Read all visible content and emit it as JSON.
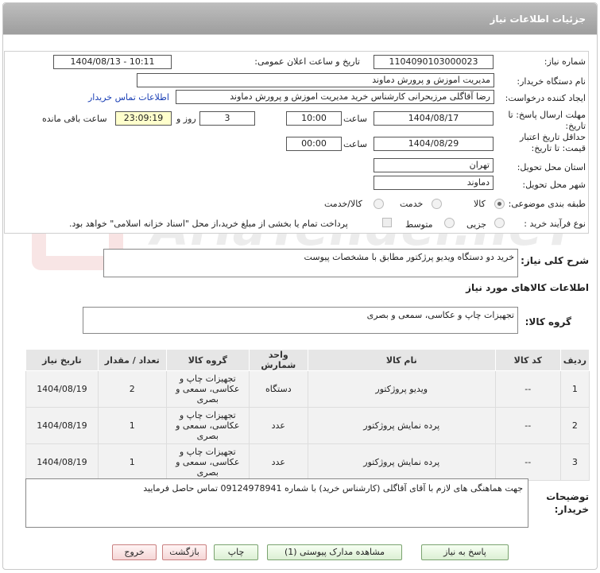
{
  "panel": {
    "title": "جزئیات اطلاعات نیاز"
  },
  "form": {
    "need_number_label": "شماره نیاز:",
    "need_number": "1104090103000023",
    "announce_label": "تاریخ و ساعت اعلان عمومی:",
    "announce_value": "1404/08/13 - 10:11",
    "buyer_org_label": "نام دستگاه خریدار:",
    "buyer_org": "مدیریت اموزش و پرورش دماوند",
    "creator_label": "ایجاد کننده درخواست:",
    "creator": "رضا آقاگلی مرزبحرانی کارشناس خرید مدیریت اموزش و پرورش دماوند",
    "contact_link": "اطلاعات تماس خریدار",
    "deadline_label": "مهلت ارسال پاسخ: تا تاریخ:",
    "deadline_date": "1404/08/17",
    "time_label": "ساعت",
    "deadline_time": "10:00",
    "days_count": "3",
    "days_label": "روز و",
    "remaining_time": "23:09:19",
    "remaining_label": "ساعت باقی مانده",
    "validity_label": "حداقل تاریخ اعتبار قیمت: تا تاریخ:",
    "validity_date": "1404/08/29",
    "validity_time": "00:00",
    "province_label": "استان محل تحویل:",
    "province": "تهران",
    "city_label": "شهر محل تحویل:",
    "city": "دماوند",
    "category_label": "طبقه بندی موضوعی:",
    "category_options": [
      "کالا",
      "خدمت",
      "کالا/خدمت"
    ],
    "process_label": "نوع فرآیند خرید :",
    "process_options": [
      "جزیی",
      "متوسط"
    ],
    "payment_note": "پرداخت تمام یا بخشی از مبلغ خرید،از محل \"اسناد خزانه اسلامی\" خواهد بود."
  },
  "summary": {
    "label": "شرح کلی نیاز:",
    "value": "خرید دو دستگاه ویدیو پرژکتور مطابق با مشخصات پیوست"
  },
  "goods": {
    "section_title": "اطلاعات کالاهای مورد نیاز",
    "group_label": "گروه کالا:",
    "group_value": "تجهیزات چاپ و عکاسی، سمعی و بصری"
  },
  "table": {
    "headers": [
      "ردیف",
      "کد کالا",
      "نام کالا",
      "واحد شمارش",
      "گروه کالا",
      "تعداد / مقدار",
      "تاریخ نیاز"
    ],
    "rows": [
      [
        "1",
        "--",
        "ویدیو پروژکتور",
        "دستگاه",
        "تجهیزات چاپ و عکاسی، سمعی و بصری",
        "2",
        "1404/08/19"
      ],
      [
        "2",
        "--",
        "پرده نمایش پروژکتور",
        "عدد",
        "تجهیزات چاپ و عکاسی، سمعی و بصری",
        "1",
        "1404/08/19"
      ],
      [
        "3",
        "--",
        "پرده نمایش پروژکتور",
        "عدد",
        "تجهیزات چاپ و عکاسی، سمعی و بصری",
        "1",
        "1404/08/19"
      ]
    ]
  },
  "notes": {
    "label": "توضیحات خریدار:",
    "value": "جهت هماهنگی های لازم با آقای آقاگلی (کارشناس خرید) با شماره 09124978941 تماس حاصل فرمایید"
  },
  "buttons": {
    "reply": "پاسخ به نیاز",
    "attachments": "مشاهده مدارک پیوستی (1)",
    "print": "چاپ",
    "back": "بازگشت",
    "exit": "خروج"
  },
  "watermark": {
    "text": "AriaTender.neT"
  }
}
